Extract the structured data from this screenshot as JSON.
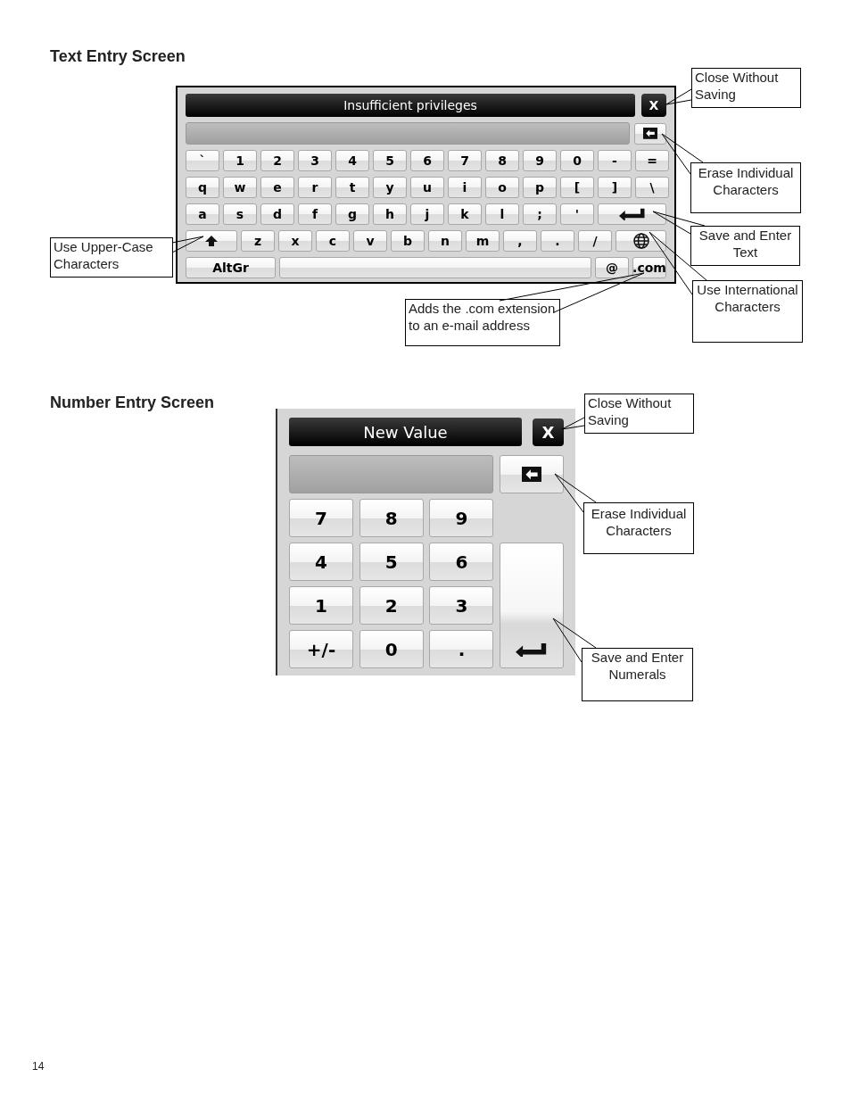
{
  "text_entry": {
    "heading": "Text Entry Screen",
    "title": "Insufficient privileges",
    "close": "X",
    "keyboard_lines": [
      {
        "keys": [
          {
            "kind": "char",
            "label": "`"
          },
          {
            "kind": "char",
            "label": "1"
          },
          {
            "kind": "char",
            "label": "2"
          },
          {
            "kind": "char",
            "label": "3"
          },
          {
            "kind": "char",
            "label": "4"
          },
          {
            "kind": "char",
            "label": "5"
          },
          {
            "kind": "char",
            "label": "6"
          },
          {
            "kind": "char",
            "label": "7"
          },
          {
            "kind": "char",
            "label": "8"
          },
          {
            "kind": "char",
            "label": "9"
          },
          {
            "kind": "char",
            "label": "0"
          },
          {
            "kind": "char",
            "label": "-"
          },
          {
            "kind": "char",
            "label": "="
          }
        ]
      },
      {
        "keys": [
          {
            "kind": "char",
            "label": "q"
          },
          {
            "kind": "char",
            "label": "w"
          },
          {
            "kind": "char",
            "label": "e"
          },
          {
            "kind": "char",
            "label": "r"
          },
          {
            "kind": "char",
            "label": "t"
          },
          {
            "kind": "char",
            "label": "y"
          },
          {
            "kind": "char",
            "label": "u"
          },
          {
            "kind": "char",
            "label": "i"
          },
          {
            "kind": "char",
            "label": "o"
          },
          {
            "kind": "char",
            "label": "p"
          },
          {
            "kind": "char",
            "label": "["
          },
          {
            "kind": "char",
            "label": "]"
          },
          {
            "kind": "char",
            "label": "\\"
          }
        ]
      },
      {
        "keys": [
          {
            "kind": "char",
            "label": "a"
          },
          {
            "kind": "char",
            "label": "s"
          },
          {
            "kind": "char",
            "label": "d"
          },
          {
            "kind": "char",
            "label": "f"
          },
          {
            "kind": "char",
            "label": "g"
          },
          {
            "kind": "char",
            "label": "h"
          },
          {
            "kind": "char",
            "label": "j"
          },
          {
            "kind": "char",
            "label": "k"
          },
          {
            "kind": "char",
            "label": "l"
          },
          {
            "kind": "char",
            "label": ";"
          },
          {
            "kind": "char",
            "label": "'"
          },
          {
            "kind": "enter"
          }
        ]
      },
      {
        "keys": [
          {
            "kind": "shift"
          },
          {
            "kind": "char",
            "label": "z"
          },
          {
            "kind": "char",
            "label": "x"
          },
          {
            "kind": "char",
            "label": "c"
          },
          {
            "kind": "char",
            "label": "v"
          },
          {
            "kind": "char",
            "label": "b"
          },
          {
            "kind": "char",
            "label": "n"
          },
          {
            "kind": "char",
            "label": "m"
          },
          {
            "kind": "char",
            "label": ","
          },
          {
            "kind": "char",
            "label": "."
          },
          {
            "kind": "char",
            "label": "/"
          },
          {
            "kind": "globe"
          }
        ]
      },
      {
        "keys": [
          {
            "kind": "wide",
            "label": "AltGr"
          },
          {
            "kind": "space"
          },
          {
            "kind": "char",
            "label": "@"
          },
          {
            "kind": "char",
            "label": ".com"
          }
        ]
      }
    ],
    "callouts": [
      "Close Without Saving",
      "Erase Individual Characters",
      "Save and Enter Text",
      "Use International Characters",
      "Adds the .com extension to an e-mail address",
      "Use Upper-Case Characters"
    ]
  },
  "number_entry": {
    "heading": "Number Entry Screen",
    "title": "New Value",
    "close": "X",
    "keys": [
      "7",
      "8",
      "9",
      "4",
      "5",
      "6",
      "1",
      "2",
      "3",
      "+/-",
      "0",
      "."
    ],
    "callouts": [
      "Close Without Saving",
      "Erase Individual Characters",
      "Save and Enter Numerals"
    ]
  },
  "page_number": "14"
}
